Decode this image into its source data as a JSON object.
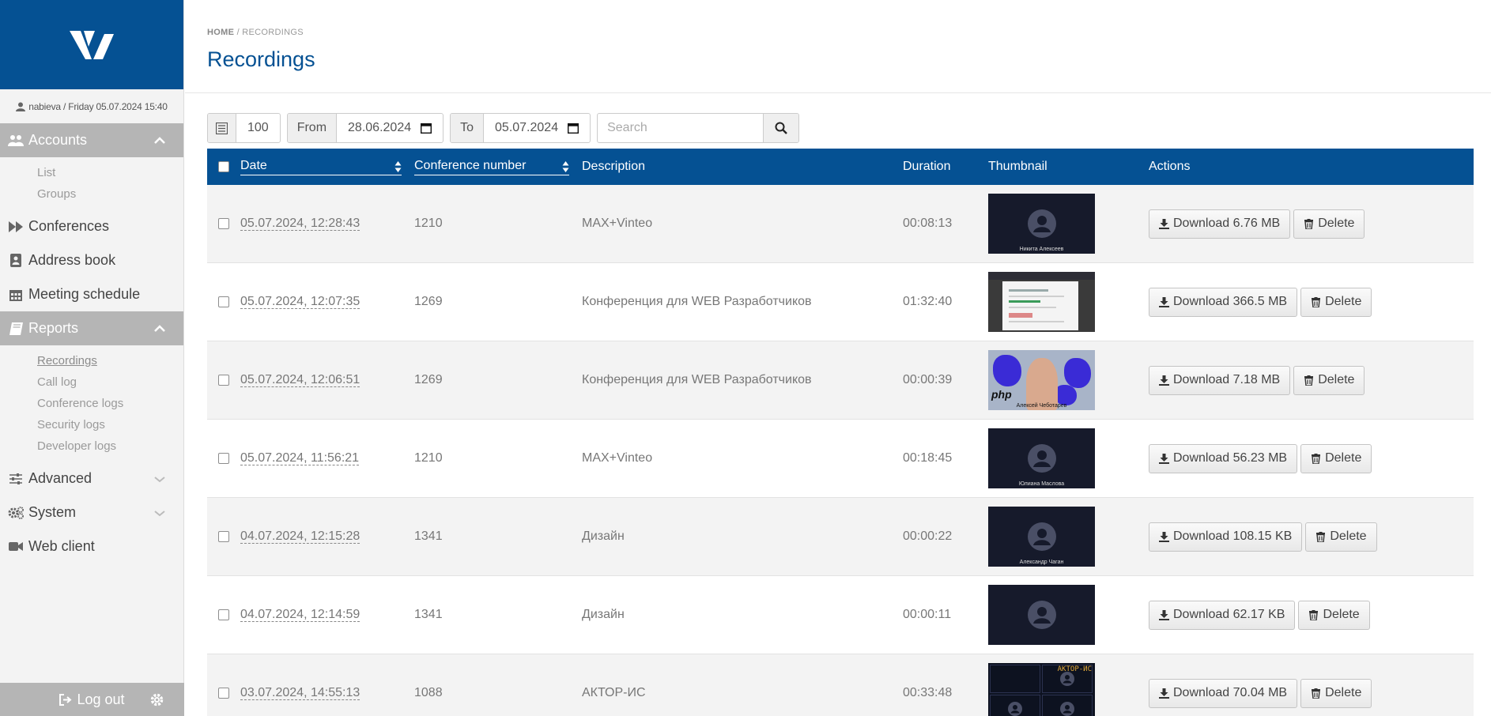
{
  "user_line": "nabieva / Friday 05.07.2024 15:40",
  "nav": {
    "accounts": "Accounts",
    "accounts_items": [
      "List",
      "Groups"
    ],
    "conferences": "Conferences",
    "address_book": "Address book",
    "meeting_schedule": "Meeting schedule",
    "reports": "Reports",
    "reports_items": [
      "Recordings",
      "Call log",
      "Conference logs",
      "Security logs",
      "Developer logs"
    ],
    "advanced": "Advanced",
    "system": "System",
    "web_client": "Web client",
    "logout": "Log out"
  },
  "breadcrumb": {
    "home": "HOME",
    "sep": "/",
    "current": "RECORDINGS"
  },
  "page_title": "Recordings",
  "toolbar": {
    "page_size": "100",
    "from_label": "From",
    "from_date": "28.06.2024",
    "to_label": "To",
    "to_date": "05.07.2024",
    "search_placeholder": "Search"
  },
  "table": {
    "headers": {
      "date": "Date",
      "conference_number": "Conference number",
      "description": "Description",
      "duration": "Duration",
      "thumbnail": "Thumbnail",
      "actions": "Actions"
    },
    "delete_label": "Delete",
    "rows": [
      {
        "date": "05.07.2024, 12:28:43",
        "conf": "1210",
        "desc": "MAX+Vinteo",
        "duration": "00:08:13",
        "thumb_name": "Никита Алексеев",
        "download": "Download 6.76 MB"
      },
      {
        "date": "05.07.2024, 12:07:35",
        "conf": "1269",
        "desc": "Конференция для WEB Разработчиков",
        "duration": "01:32:40",
        "thumb_name": "",
        "download": "Download 366.5 MB"
      },
      {
        "date": "05.07.2024, 12:06:51",
        "conf": "1269",
        "desc": "Конференция для WEB Разработчиков",
        "duration": "00:00:39",
        "thumb_name": "Алексей Чеботарев",
        "thumb_text": "php",
        "download": "Download 7.18 MB"
      },
      {
        "date": "05.07.2024, 11:56:21",
        "conf": "1210",
        "desc": "MAX+Vinteo",
        "duration": "00:18:45",
        "thumb_name": "Юлиана Маслова",
        "download": "Download 56.23 MB"
      },
      {
        "date": "04.07.2024, 12:15:28",
        "conf": "1341",
        "desc": "Дизайн",
        "duration": "00:00:22",
        "thumb_name": "Александр Чаган",
        "download": "Download 108.15 KB"
      },
      {
        "date": "04.07.2024, 12:14:59",
        "conf": "1341",
        "desc": "Дизайн",
        "duration": "00:00:11",
        "thumb_name": "",
        "download": "Download 62.17 KB"
      },
      {
        "date": "03.07.2024, 14:55:13",
        "conf": "1088",
        "desc": "АКТОР-ИС",
        "duration": "00:33:48",
        "thumb_name": "",
        "thumb_text": "АКТОР-ИС",
        "download": "Download 70.04 MB"
      }
    ]
  },
  "colors": {
    "brand": "#055193",
    "sidebar_active": "#b5b5b5",
    "row_alt": "#f3f3f3"
  }
}
